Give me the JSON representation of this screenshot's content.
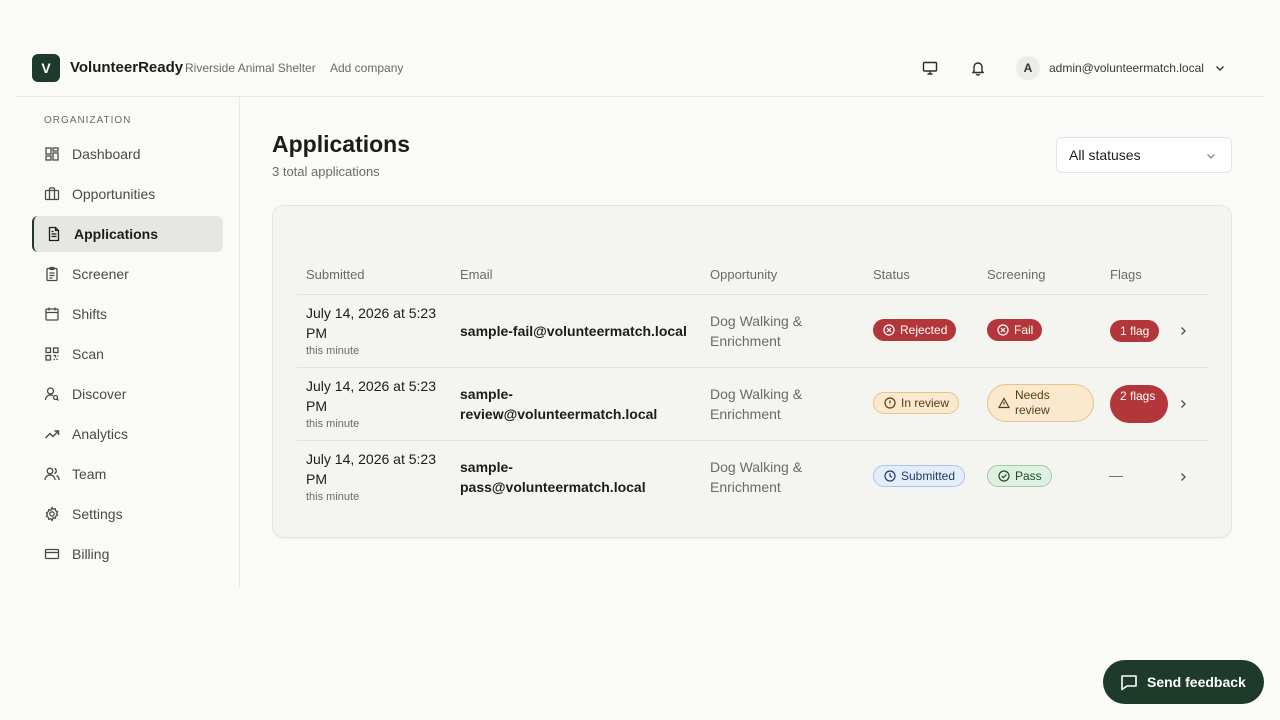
{
  "header": {
    "logo_letter": "V",
    "app_name": "VolunteerReady",
    "org_name": "Riverside Animal Shelter",
    "add_company": "Add company",
    "user_initial": "A",
    "user_email": "admin@volunteermatch.local"
  },
  "sidebar": {
    "heading": "ORGANIZATION",
    "items": [
      {
        "label": "Dashboard",
        "icon": "dashboard-icon"
      },
      {
        "label": "Opportunities",
        "icon": "briefcase-icon"
      },
      {
        "label": "Applications",
        "icon": "document-icon",
        "active": true
      },
      {
        "label": "Screener",
        "icon": "clipboard-icon"
      },
      {
        "label": "Shifts",
        "icon": "calendar-icon"
      },
      {
        "label": "Scan",
        "icon": "qr-code-icon"
      },
      {
        "label": "Discover",
        "icon": "user-search-icon"
      },
      {
        "label": "Analytics",
        "icon": "trending-up-icon"
      },
      {
        "label": "Team",
        "icon": "users-icon"
      },
      {
        "label": "Settings",
        "icon": "gear-icon"
      },
      {
        "label": "Billing",
        "icon": "credit-card-icon"
      }
    ]
  },
  "main": {
    "title": "Applications",
    "subtitle": "3 total applications",
    "filter": {
      "selected": "All statuses"
    },
    "table": {
      "columns": [
        "Submitted",
        "Email",
        "Opportunity",
        "Status",
        "Screening",
        "Flags"
      ],
      "rows": [
        {
          "date": "July 14, 2026 at 5:23 PM",
          "relative": "this minute",
          "email": "sample-fail@volunteermatch.local",
          "opportunity": "Dog Walking & Enrichment",
          "status": "Rejected",
          "screening": "Fail",
          "flags": "1 flag"
        },
        {
          "date": "July 14, 2026 at 5:23 PM",
          "relative": "this minute",
          "email": "sample-review@volunteermatch.local",
          "opportunity": "Dog Walking & Enrichment",
          "status": "In review",
          "screening": "Needs review",
          "flags": "2 flags"
        },
        {
          "date": "July 14, 2026 at 5:23 PM",
          "relative": "this minute",
          "email": "sample-pass@volunteermatch.local",
          "opportunity": "Dog Walking & Enrichment",
          "status": "Submitted",
          "screening": "Pass",
          "flags": "—"
        }
      ]
    }
  },
  "feedback": {
    "label": "Send feedback"
  },
  "colors": {
    "brand": "#1e3a2a",
    "danger": "#b3373a",
    "warning_bg": "#fbe9cf",
    "info_bg": "#e4eefb",
    "success_bg": "#ddf0e2"
  }
}
